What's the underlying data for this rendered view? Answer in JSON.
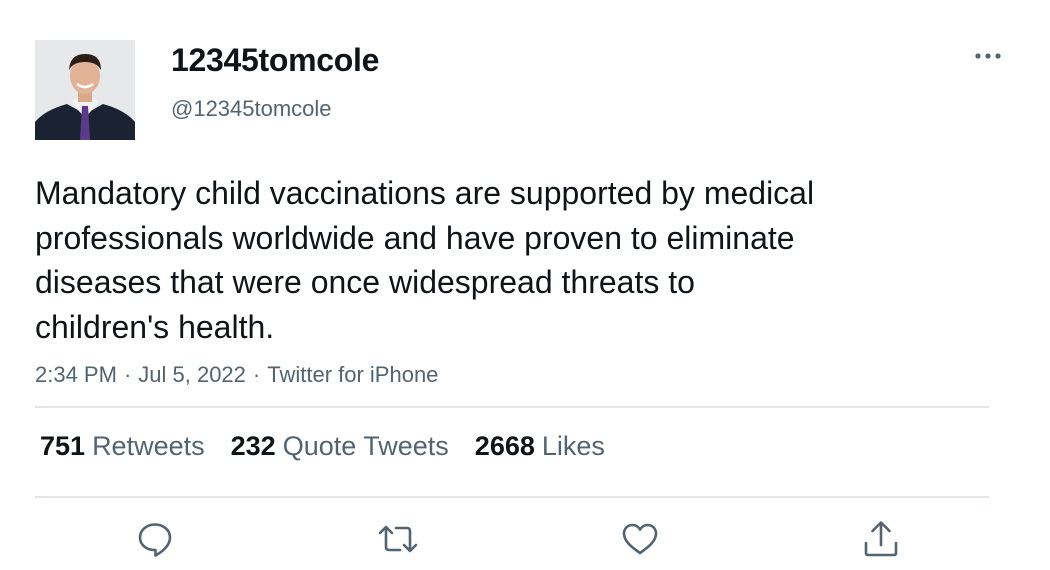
{
  "tweet": {
    "display_name": "12345tomcole",
    "handle": "@12345tomcole",
    "text": "Mandatory child vaccinations are supported by medical\nprofessionals worldwide and have proven to eliminate\ndiseases that were once widespread threats to\nchildren's health.",
    "time": "2:34 PM",
    "date": "Jul 5, 2022",
    "source": "Twitter for iPhone",
    "separator": "·"
  },
  "stats": {
    "retweets_count": "751",
    "retweets_label": "Retweets",
    "quotes_count": "232",
    "quotes_label": "Quote Tweets",
    "likes_count": "2668",
    "likes_label": "Likes"
  },
  "actions": [
    {
      "icon": "reply-icon"
    },
    {
      "icon": "retweet-icon"
    },
    {
      "icon": "heart-icon"
    },
    {
      "icon": "share-icon"
    }
  ],
  "colors": {
    "text_primary": "#0f1419",
    "text_secondary": "#536471",
    "divider": "#e1e6ea"
  }
}
